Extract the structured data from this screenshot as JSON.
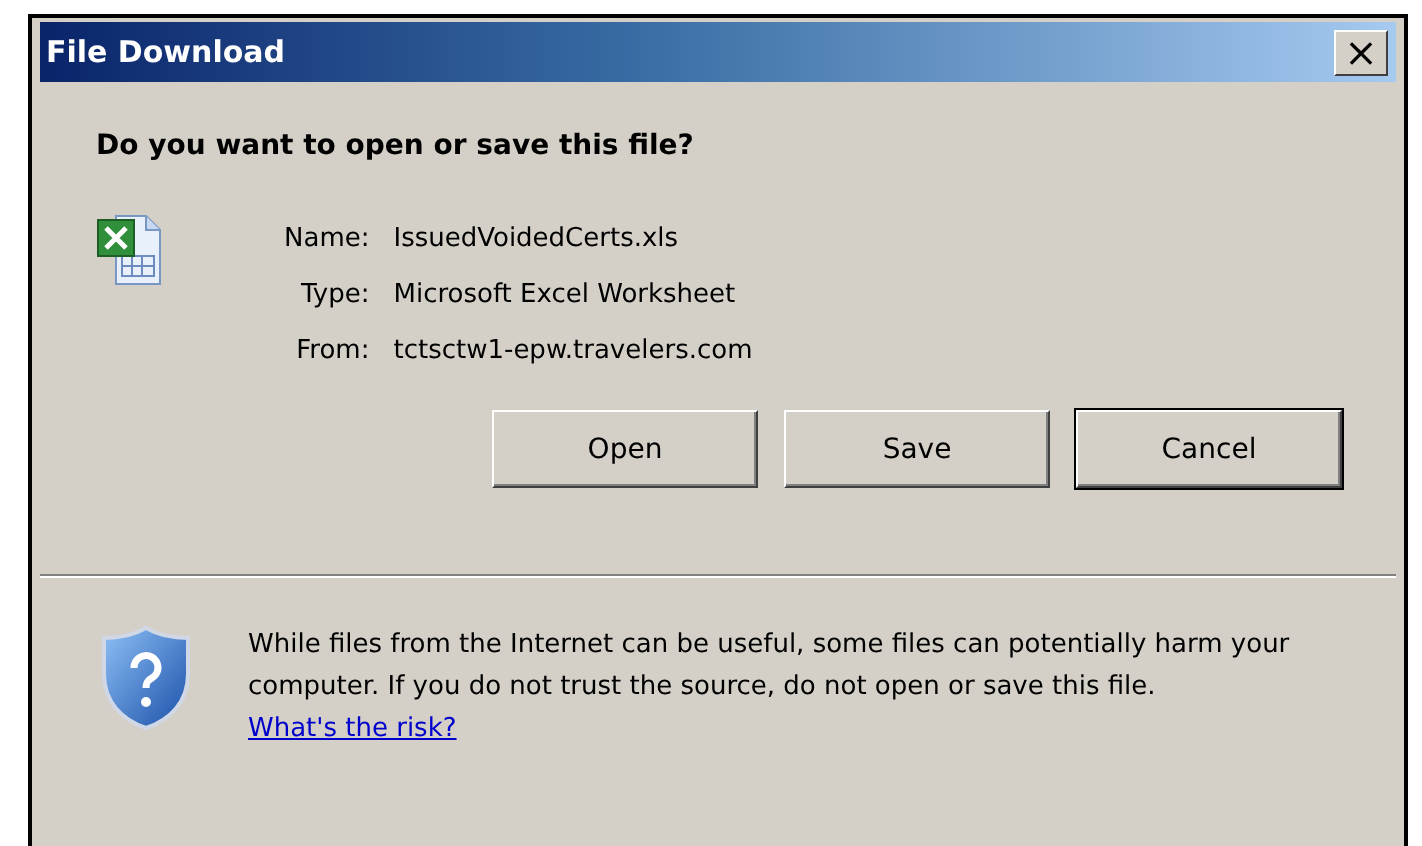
{
  "window": {
    "title": "File Download",
    "close": "×"
  },
  "question": "Do you want to open or save this file?",
  "file_info": [
    {
      "label": "Name:",
      "value": "IssuedVoidedCerts.xls"
    },
    {
      "label": "Type:",
      "value": "Microsoft Excel Worksheet"
    },
    {
      "label": "From:",
      "value": "tctsctw1-epw.travelers.com"
    }
  ],
  "buttons": [
    {
      "label": "Open",
      "default": false
    },
    {
      "label": "Save",
      "default": false
    },
    {
      "label": "Cancel",
      "default": true
    }
  ],
  "warning": {
    "text": "While files from the Internet can be useful, some files can potentially harm your computer. If you do not trust the source, do not open or save this file.",
    "link": "What's the risk?"
  }
}
